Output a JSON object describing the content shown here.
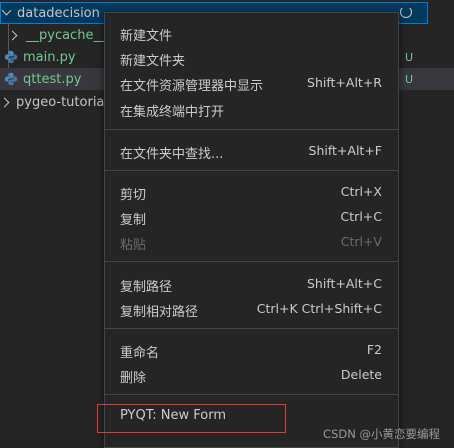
{
  "explorer": {
    "root_folder": "datadecision",
    "items": [
      {
        "label": "__pycache__",
        "type": "folder"
      },
      {
        "label": "main.py",
        "type": "python-file",
        "badge": "U"
      },
      {
        "label": "qttest.py",
        "type": "python-file",
        "badge": "U"
      },
      {
        "label": "pygeo-tutoria",
        "type": "folder"
      }
    ]
  },
  "context_menu": {
    "groups": [
      [
        {
          "label": "新建文件",
          "shortcut": ""
        },
        {
          "label": "新建文件夹",
          "shortcut": ""
        },
        {
          "label": "在文件资源管理器中显示",
          "shortcut": "Shift+Alt+R"
        },
        {
          "label": "在集成终端中打开",
          "shortcut": ""
        }
      ],
      [
        {
          "label": "在文件夹中查找...",
          "shortcut": "Shift+Alt+F"
        }
      ],
      [
        {
          "label": "剪切",
          "shortcut": "Ctrl+X"
        },
        {
          "label": "复制",
          "shortcut": "Ctrl+C"
        },
        {
          "label": "粘贴",
          "shortcut": "Ctrl+V",
          "disabled": true
        }
      ],
      [
        {
          "label": "复制路径",
          "shortcut": "Shift+Alt+C"
        },
        {
          "label": "复制相对路径",
          "shortcut": "Ctrl+K Ctrl+Shift+C"
        }
      ],
      [
        {
          "label": "重命名",
          "shortcut": "F2"
        },
        {
          "label": "删除",
          "shortcut": "Delete"
        }
      ],
      [
        {
          "label": "PYQT: New Form",
          "shortcut": "",
          "highlighted": true
        }
      ]
    ]
  },
  "watermark": "CSDN @小黄恋要编程",
  "colors": {
    "background": "#252526",
    "menu_border": "#454545",
    "selection_border": "#007fd4",
    "untracked_green": "#73c991",
    "highlight_box": "#e53935",
    "disabled_text": "#6b6b6b"
  }
}
